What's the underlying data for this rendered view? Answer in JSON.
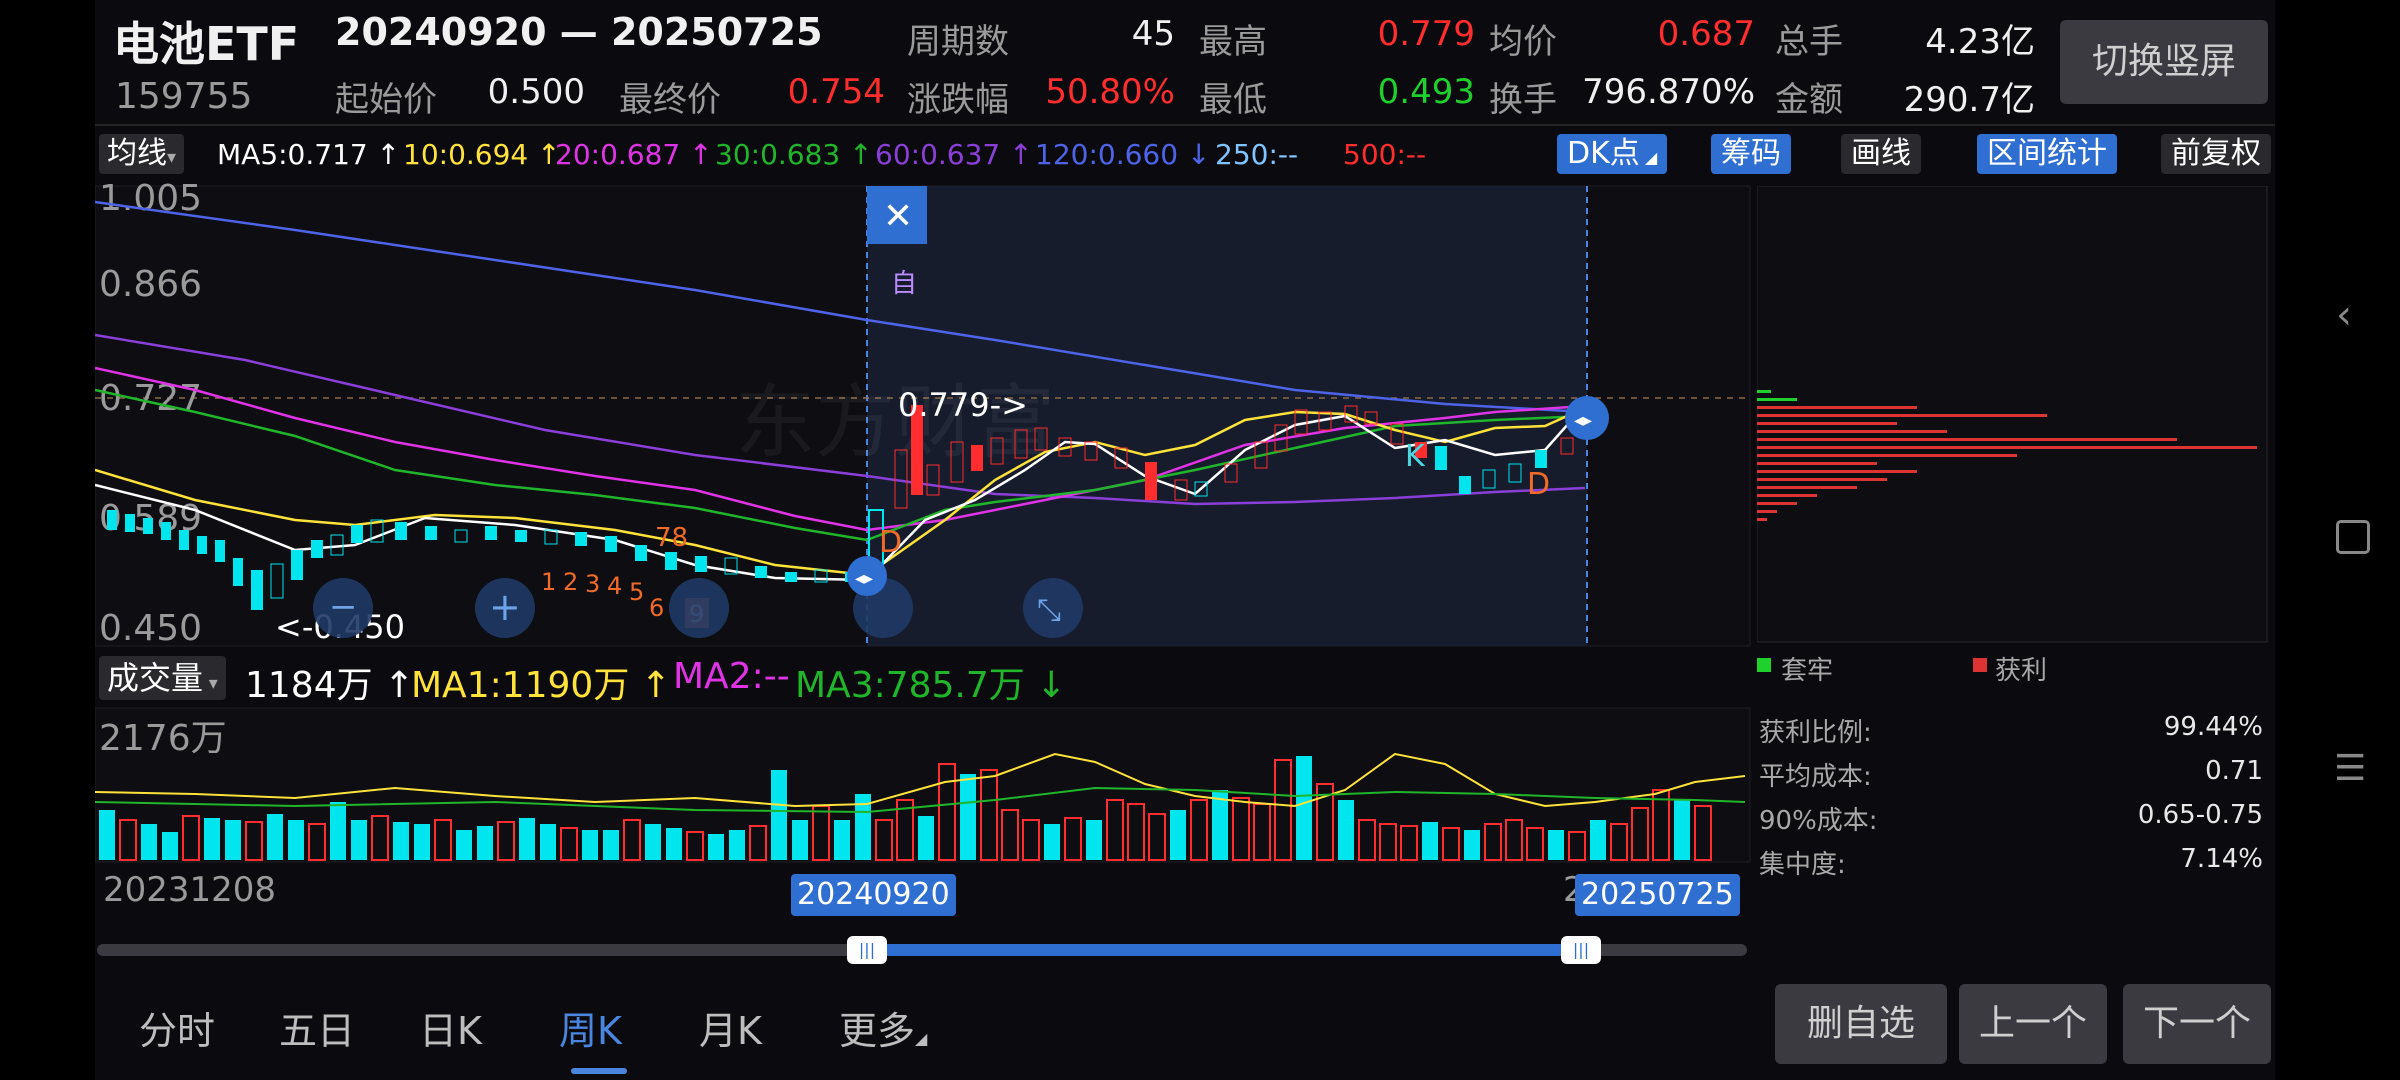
{
  "header": {
    "name": "电池ETF",
    "code": "159755",
    "date_range": "20240920 — 20250725",
    "stats": {
      "period_label": "周期数",
      "period_value": "45",
      "high_label": "最高",
      "high_value": "0.779",
      "avg_label": "均价",
      "avg_value": "0.687",
      "total_vol_label": "总手",
      "total_vol_value": "4.23亿",
      "start_label": "起始价",
      "start_value": "0.500",
      "end_label": "最终价",
      "end_value": "0.754",
      "change_label": "涨跌幅",
      "change_value": "50.80%",
      "low_label": "最低",
      "low_value": "0.493",
      "turnover_label": "换手",
      "turnover_value": "796.870%",
      "amount_label": "金额",
      "amount_value": "290.7亿"
    },
    "switch_button": "切换竖屏"
  },
  "indicator_bar": {
    "selector": "均线",
    "ma5": "MA5:0.717",
    "ma10": "10:0.694",
    "ma20": "20:0.687",
    "ma30": "30:0.683",
    "ma60": "60:0.637",
    "ma120": "120:0.660",
    "ma250": "250:--",
    "ma500": "500:--",
    "buttons": [
      "DK点",
      "筹码",
      "画线",
      "区间统计",
      "前复权"
    ]
  },
  "chart": {
    "y_labels": [
      "1.005",
      "0.866",
      "0.727",
      "0.589",
      "0.450"
    ],
    "high_marker": "0.779->",
    "low_marker": "<-0.450",
    "self_tag": "自",
    "close_icon": "close-icon",
    "signal_numbers": [
      "78",
      "1",
      "2",
      "3",
      "4",
      "5",
      "6",
      "9"
    ],
    "signal_letters": [
      "D",
      "K",
      "D"
    ],
    "watermark": "东方财富"
  },
  "volume_bar": {
    "selector": "成交量",
    "vol": "1184万",
    "ma1": "MA1:1190万",
    "ma2": "MA2:--",
    "ma3": "MA3:785.7万",
    "max_label": "2176万"
  },
  "timeline": {
    "start_date": "20231208",
    "sel_start": "20240920",
    "sel_end": "20250725",
    "partial_prefix": "2"
  },
  "chip_panel": {
    "legend_trapped": "套牢",
    "legend_profit": "获利",
    "stats": [
      {
        "label": "获利比例:",
        "value": "99.44%"
      },
      {
        "label": "平均成本:",
        "value": "0.71"
      },
      {
        "label": "90%成本:",
        "value": "0.65-0.75"
      },
      {
        "label": "集中度:",
        "value": "7.14%"
      }
    ]
  },
  "bottom_tabs": [
    "分时",
    "五日",
    "日K",
    "周K",
    "月K",
    "更多"
  ],
  "active_tab": "周K",
  "actions": {
    "remove": "删自选",
    "prev": "上一个",
    "next": "下一个"
  },
  "colors": {
    "up": "#ff2d2d",
    "down": "#00e5ee",
    "accent": "#2f6fd1",
    "ma5": "#ffffff",
    "ma10": "#ffe23a",
    "ma20": "#e033e6",
    "ma30": "#20b52a",
    "ma60": "#8b3fd9",
    "ma120": "#4e63e8"
  }
}
